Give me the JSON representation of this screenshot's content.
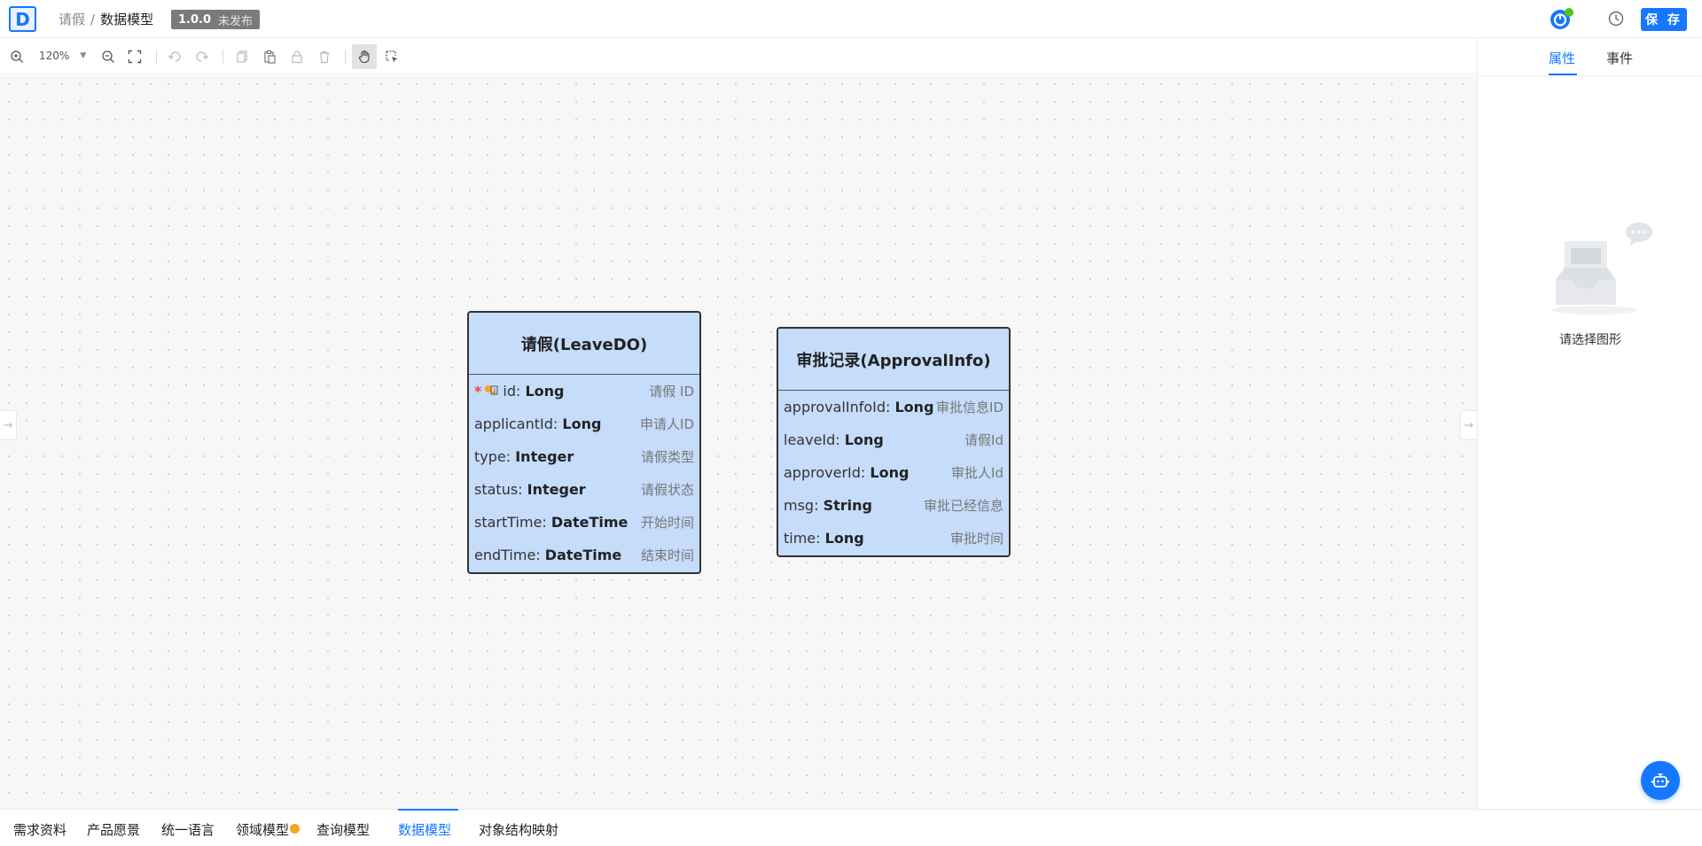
{
  "header": {
    "logo_letter": "D",
    "breadcrumb": [
      "请假",
      "/",
      "数据模型"
    ],
    "version": "1.0.0",
    "version_status": "未发布",
    "save_label": "保 存",
    "accent_color": "#1677ff",
    "online_color": "#52c41a"
  },
  "toolbar": {
    "zoom_level": "120%",
    "tools": [
      "zoom-in-icon",
      "zoom-out-icon",
      "fit-screen-icon",
      "undo-icon",
      "redo-icon",
      "copy-icon",
      "paste-icon",
      "lock-icon",
      "delete-icon",
      "hand-pan-icon",
      "box-select-icon"
    ]
  },
  "entities": [
    {
      "title": "请假(LeaveDO)",
      "fields": [
        {
          "name": "id: ",
          "type": "Long",
          "comment": "请假 ID",
          "primary_key": true,
          "required": true
        },
        {
          "name": "applicantId: ",
          "type": "Long",
          "comment": "申请人ID"
        },
        {
          "name": "type: ",
          "type": "Integer",
          "comment": "请假类型"
        },
        {
          "name": "status: ",
          "type": "Integer",
          "comment": "请假状态"
        },
        {
          "name": "startTime: ",
          "type": "DateTime",
          "comment": "开始时间"
        },
        {
          "name": "endTime: ",
          "type": "DateTime",
          "comment": "结束时间"
        }
      ]
    },
    {
      "title": "审批记录(ApprovalInfo)",
      "fields": [
        {
          "name": "approvalInfoId: ",
          "type": "Long",
          "comment": "审批信息ID"
        },
        {
          "name": "leaveId: ",
          "type": "Long",
          "comment": "请假Id"
        },
        {
          "name": "approverId: ",
          "type": "Long",
          "comment": "审批人Id"
        },
        {
          "name": "msg: ",
          "type": "String",
          "comment": "审批已经信息"
        },
        {
          "name": "time: ",
          "type": "Long",
          "comment": "审批时间"
        }
      ]
    }
  ],
  "right_panel": {
    "tabs": [
      {
        "label": "属性",
        "active": true
      },
      {
        "label": "事件",
        "active": false
      }
    ],
    "empty_text": "请选择图形"
  },
  "bottom_tabs": [
    {
      "label": "需求资料"
    },
    {
      "label": "产品愿景"
    },
    {
      "label": "统一语言"
    },
    {
      "label": "领域模型",
      "warning": true
    },
    {
      "label": "查询模型"
    },
    {
      "label": "数据模型",
      "active": true
    },
    {
      "label": "对象结构映射"
    }
  ]
}
